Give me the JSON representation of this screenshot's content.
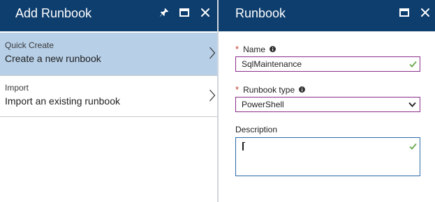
{
  "add_runbook_blade": {
    "title": "Add Runbook",
    "items": [
      {
        "subtitle": "Quick Create",
        "label": "Create a new runbook",
        "selected": true
      },
      {
        "subtitle": "Import",
        "label": "Import an existing runbook",
        "selected": false
      }
    ]
  },
  "runbook_blade": {
    "title": "Runbook",
    "name_field": {
      "label": "Name",
      "required": true,
      "value": "SqlMaintenance",
      "valid": true
    },
    "type_field": {
      "label": "Runbook type",
      "required": true,
      "value": "PowerShell"
    },
    "description_field": {
      "label": "Description",
      "value": "",
      "valid": true
    }
  },
  "colors": {
    "header_bg": "#0e3e6e",
    "selected_item_bg": "#b7cfe7",
    "required_star": "#c0392b",
    "input_border": "#8a2e8a",
    "focus_border": "#2b6aa8",
    "valid_check": "#6aa84f"
  },
  "icons": {
    "pin": "pin-icon",
    "maximize": "maximize-icon",
    "close": "close-icon",
    "chevron_right": "chevron-right-icon",
    "info": "info-icon",
    "check": "checkmark-icon",
    "chevron_down": "chevron-down-icon"
  }
}
